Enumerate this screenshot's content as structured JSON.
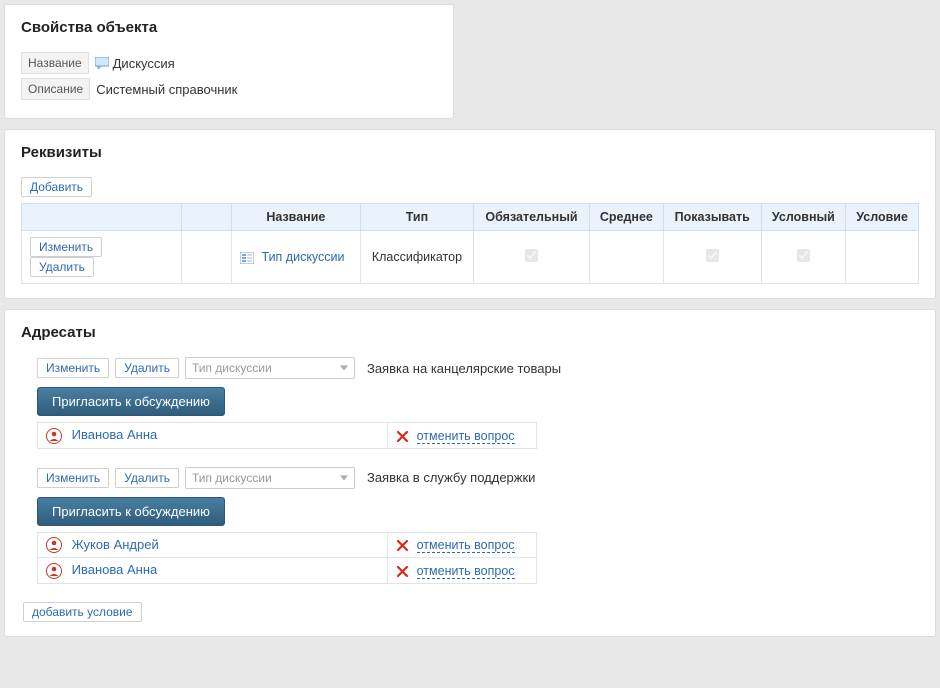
{
  "properties": {
    "heading": "Свойства объекта",
    "name_label": "Название",
    "name_value": "Дискуссия",
    "desc_label": "Описание",
    "desc_value": "Системный справочник"
  },
  "requisites": {
    "heading": "Реквизиты",
    "add_label": "Добавить",
    "headers": {
      "name": "Название",
      "type": "Тип",
      "required": "Обязательный",
      "average": "Среднее",
      "show": "Показывать",
      "conditional": "Условный",
      "condition": "Условие"
    },
    "row": {
      "edit_label": "Изменить",
      "delete_label": "Удалить",
      "name_link": "Тип дискуссии",
      "type_value": "Классификатор"
    }
  },
  "addressees": {
    "heading": "Адресаты",
    "edit_label": "Изменить",
    "delete_label": "Удалить",
    "dropdown_placeholder": "Тип дискуссии",
    "invite_label": "Пригласить к обсуждению",
    "cancel_label": "отменить вопрос",
    "add_condition_label": "добавить условие",
    "groups": [
      {
        "title": "Заявка на канцелярские товары",
        "users": [
          "Иванова Анна"
        ]
      },
      {
        "title": "Заявка в службу поддержки",
        "users": [
          "Жуков Андрей",
          "Иванова Анна"
        ]
      }
    ]
  }
}
